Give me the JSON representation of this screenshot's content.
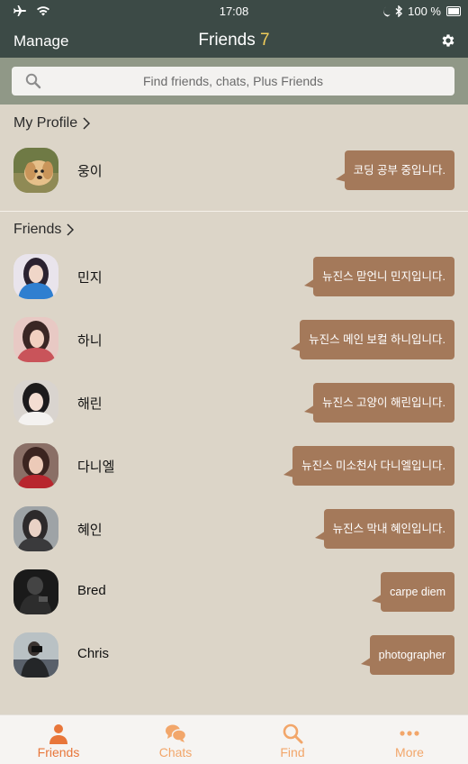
{
  "status": {
    "time": "17:08",
    "battery": "100 %"
  },
  "header": {
    "manage_label": "Manage",
    "title": "Friends",
    "count": "7"
  },
  "search": {
    "placeholder": "Find friends, chats, Plus Friends"
  },
  "my_profile": {
    "section_label": "My Profile",
    "name": "웅이",
    "status_message": "코딩 공부 중입니다."
  },
  "friends": {
    "section_label": "Friends",
    "items": [
      {
        "name": "민지",
        "status_message": "뉴진스 맏언니 민지입니다."
      },
      {
        "name": "하니",
        "status_message": "뉴진스 메인 보컬 하니입니다."
      },
      {
        "name": "해린",
        "status_message": "뉴진스 고양이 해린입니다."
      },
      {
        "name": "다니엘",
        "status_message": "뉴진스 미소천사 다니엘입니다."
      },
      {
        "name": "혜인",
        "status_message": "뉴진스 막내 혜인입니다."
      },
      {
        "name": "Bred",
        "status_message": "carpe diem"
      },
      {
        "name": "Chris",
        "status_message": "photographer"
      }
    ]
  },
  "tabs": [
    {
      "label": "Friends",
      "icon": "person-icon",
      "active": true
    },
    {
      "label": "Chats",
      "icon": "chat-bubbles-icon",
      "active": false
    },
    {
      "label": "Find",
      "icon": "search-icon",
      "active": false
    },
    {
      "label": "More",
      "icon": "more-dots-icon",
      "active": false
    }
  ],
  "colors": {
    "header_bg": "#3c4a46",
    "search_bar_bg": "#909887",
    "list_bg": "#dcd5c8",
    "bubble_bg": "#a4795a",
    "accent_count": "#f0cd5a",
    "tab_active": "#e8763a",
    "tab_inactive": "#f2a66a"
  }
}
